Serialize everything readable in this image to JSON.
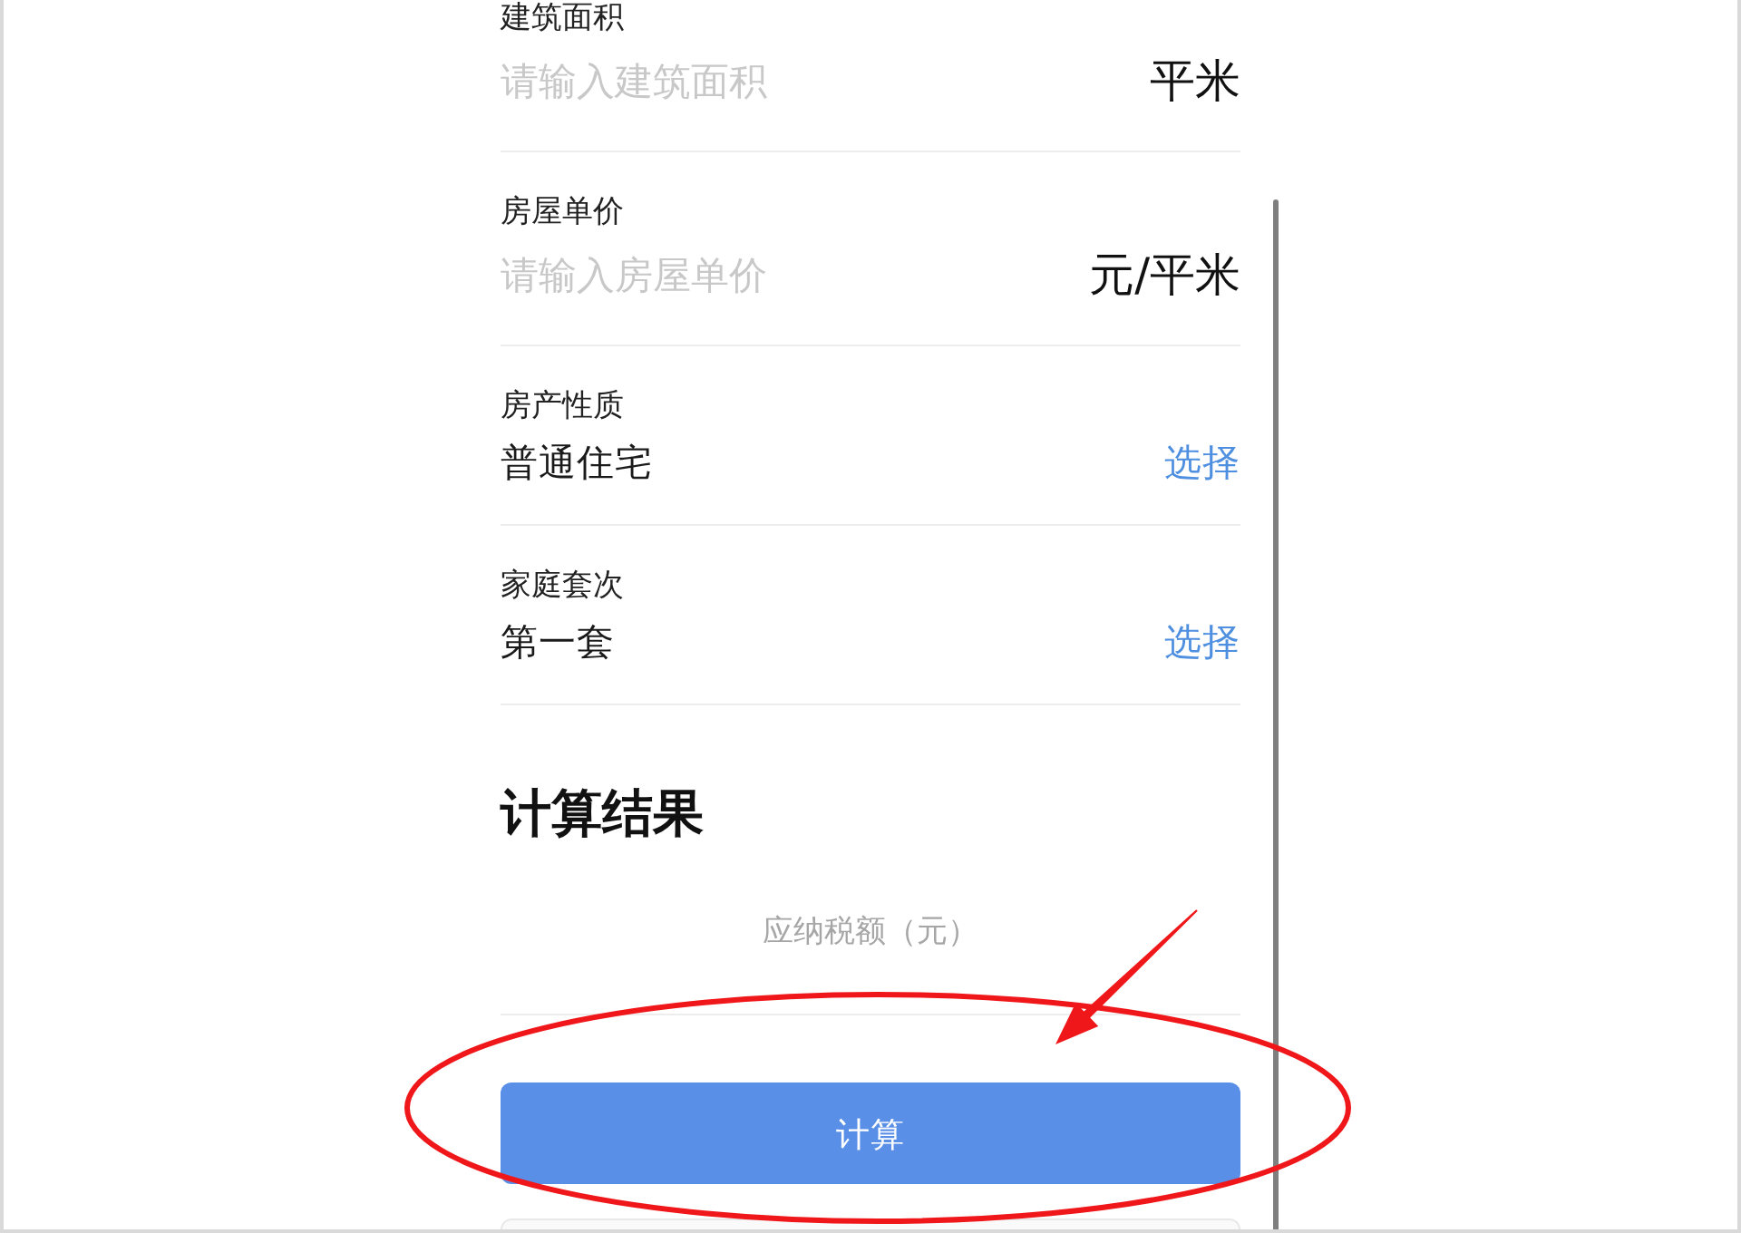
{
  "form": {
    "fields": [
      {
        "kind": "input",
        "label": "建筑面积",
        "placeholder": "请输入建筑面积",
        "unit": "平米"
      },
      {
        "kind": "input",
        "label": "房屋单价",
        "placeholder": "请输入房屋单价",
        "unit": "元/平米"
      },
      {
        "kind": "select",
        "label": "房产性质",
        "value": "普通住宅",
        "action": "选择"
      },
      {
        "kind": "select",
        "label": "家庭套次",
        "value": "第一套",
        "action": "选择"
      }
    ]
  },
  "result": {
    "title": "计算结果",
    "label": "应纳税额（元）"
  },
  "calculate_button": {
    "label": "计算"
  },
  "annotations": [
    {
      "kind": "ellipse"
    },
    {
      "kind": "arrow"
    }
  ]
}
